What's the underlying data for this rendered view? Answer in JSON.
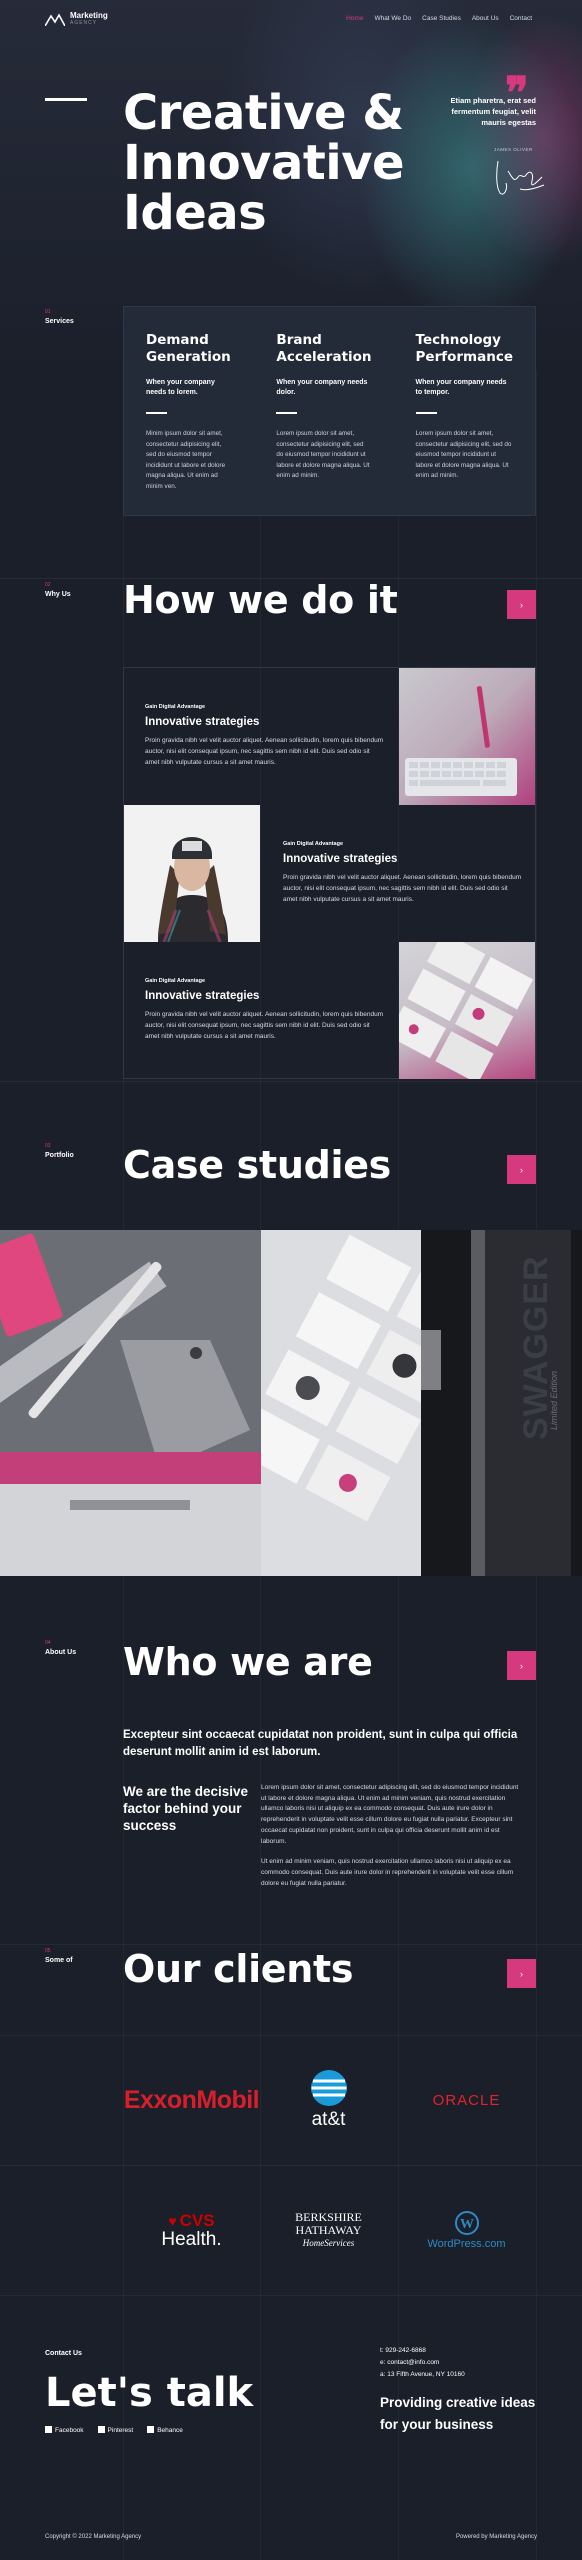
{
  "header": {
    "logo_title": "Marketing",
    "logo_subtitle": "AGENCY",
    "nav": [
      "Home",
      "What We Do",
      "Case Studies",
      "About Us",
      "Contact"
    ]
  },
  "hero": {
    "title_lines": [
      "Creative &",
      "Innovative",
      "Ideas"
    ],
    "quote": "Etiam pharetra, erat sed fermentum feugiat, velit mauris egestas",
    "author": "JAMES OLIVER"
  },
  "services": {
    "num": "01",
    "label": "Services",
    "items": [
      {
        "title": "Demand Generation",
        "sub": "When your company needs to lorem.",
        "body": "Minim ipsum dolor sit amet, consectetur adipisicing elit, sed do eiusmod tempor incididunt ut labore et dolore magna aliqua. Ut enim ad minim ven."
      },
      {
        "title": "Brand Acceleration",
        "sub": "When your company needs dolor.",
        "body": "Lorem ipsum dolor sit amet, consectetur adipisicing elit, sed do eiusmod tempor incididunt ut labore et dolore magna aliqua. Ut enim ad minim."
      },
      {
        "title": "Technology Performance",
        "sub": "When your company needs to tempor.",
        "body": "Lorem ipsum dolor sit amet, consectetur adipisicing elit, sed do eiusmod tempor incididunt ut labore et dolore magna aliqua. Ut enim ad minim."
      }
    ]
  },
  "how": {
    "num": "02",
    "label": "Why Us",
    "title": "How we do it",
    "button": "›",
    "items": [
      {
        "kicker": "Gain Digital Advantage",
        "title": "Innovative strategies",
        "body": "Proin gravida nibh vel velit auctor aliquet. Aenean sollicitudin, lorem quis bibendum auctor, nisi elit consequat ipsum, nec sagittis sem nibh id elit. Duis sed odio sit amet nibh vulputate cursus a sit amet mauris."
      },
      {
        "kicker": "Gain Digital Advantage",
        "title": "Innovative strategies",
        "body": "Proin gravida nibh vel velit auctor aliquet. Aenean sollicitudin, lorem quis bibendum auctor, nisi elit consequat ipsum, nec sagittis sem nibh id elit. Duis sed odio sit amet nibh vulputate cursus a sit amet mauris."
      },
      {
        "kicker": "Gain Digital Advantage",
        "title": "Innovative strategies",
        "body": "Proin gravida nibh vel velit auctor aliquet. Aenean sollicitudin, lorem quis bibendum auctor, nisi elit consequat ipsum, nec sagittis sem nibh id elit. Duis sed odio sit amet nibh vulputate cursus a sit amet mauris."
      }
    ]
  },
  "cases": {
    "num": "03",
    "label": "Portfolio",
    "title": "Case studies",
    "button": "›",
    "bottle_text": "SWAGGER",
    "bottle_sub": "Limited Edition"
  },
  "about": {
    "num": "04",
    "label": "About Us",
    "title": "Who we are",
    "button": "›",
    "lead": "Excepteur sint occaecat cupidatat non proident, sunt in culpa qui officia deserunt mollit anim id est laborum.",
    "heading": "We are the decisive factor behind your success",
    "para1": "Lorem ipsum dolor sit amet, consectetur adipiscing elit, sed do eiusmod tempor incididunt ut labore et dolore magna aliqua. Ut enim ad minim veniam, quis nostrud exercitation ullamco laboris nisi ut aliquip ex ea commodo consequat. Duis aute irure dolor in reprehenderit in voluptate velit esse cillum dolore eu fugiat nulla pariatur. Excepteur sint occaecat cupidatat non proident, sunt in culpa qui officia deserunt mollit anim id est laborum.",
    "para2": "Ut enim ad minim veniam, quis nostrud exercitation ullamco laboris nisi ut aliquip ex ea commodo consequat. Duis aute irure dolor in reprehenderit in voluptate velit esse cillum dolore eu fugiat nulla pariatur."
  },
  "clients": {
    "num": "05",
    "label": "Some of",
    "title": "Our clients",
    "button": "›",
    "logos": {
      "exxon": "ExxonMobil",
      "att": "at&t",
      "oracle": "ORACLE",
      "cvs_top": "CVS",
      "cvs_bottom": "Health.",
      "bh_line1": "BERKSHIRE",
      "bh_line2": "HATHAWAY",
      "bh_line3": "HomeServices",
      "wp": "WordPress.com"
    }
  },
  "footer": {
    "contact_label": "Contact Us",
    "title": "Let's talk",
    "social": [
      "Facebook",
      "Pinterest",
      "Behance"
    ],
    "phone": "t: 929-242-6868",
    "email": "e: contact@info.com",
    "address": "a: 13 Fifth Avenue, NY 10160",
    "slogan": "Providing creative ideas for your business",
    "copyright": "Copyright © 2022 Marketing Agency",
    "powered": "Powered by Marketing Agency"
  },
  "colors": {
    "background": "#1b1f2a",
    "accent": "#d6397d",
    "card": "#232a38"
  }
}
